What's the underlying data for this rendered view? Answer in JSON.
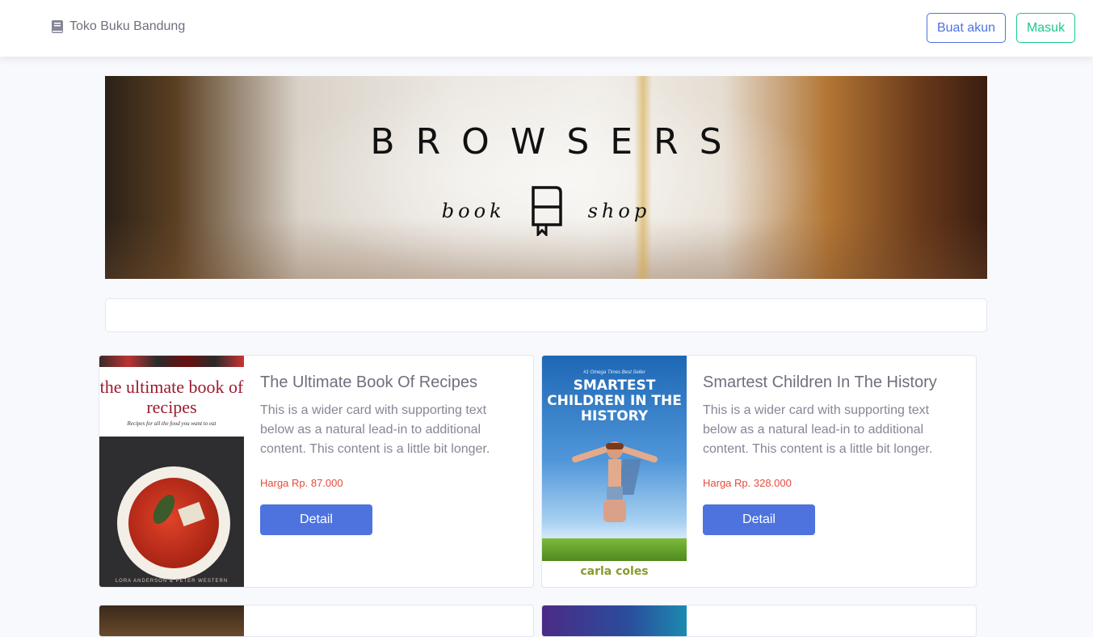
{
  "navbar": {
    "brand": "Toko Buku Bandung",
    "brand_icon": "book-icon",
    "signup_label": "Buat akun",
    "login_label": "Masuk"
  },
  "banner": {
    "title": "BROWSERS",
    "sub_left": "book",
    "sub_right": "shop",
    "logo_icon": "bookmark-logo-icon"
  },
  "search": {
    "value": "",
    "placeholder": ""
  },
  "products": [
    {
      "title": "The Ultimate Book Of Recipes",
      "description": "This is a wider card with supporting text below as a natural lead-in to additional content. This content is a little bit longer.",
      "price": "Harga Rp. 87.000",
      "button": "Detail",
      "cover": {
        "title": "the ultimate book of recipes",
        "subtitle": "Recipes for all the food you want to eat",
        "authors": "LORA ANDERSON & PETER WESTERN"
      }
    },
    {
      "title": "Smartest Children In The History",
      "description": "This is a wider card with supporting text below as a natural lead-in to additional content. This content is a little bit longer.",
      "price": "Harga Rp. 328.000",
      "button": "Detail",
      "cover": {
        "tagline": "#1 Omega Times Best Seller",
        "title": "SMARTEST CHILDREN IN THE HISTORY",
        "author": "carla coles"
      }
    }
  ],
  "colors": {
    "primary": "#4e73df",
    "success": "#1cc88a",
    "danger": "#e74a3b",
    "background": "#f8f9fc"
  }
}
